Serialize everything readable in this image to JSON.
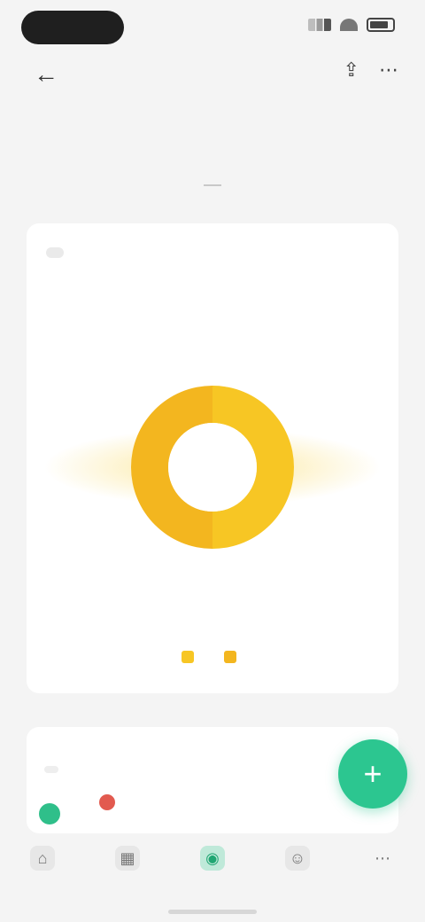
{
  "status_bar": {
    "time": ""
  },
  "header": {
    "title": ""
  },
  "tabs": [
    {
      "label": ""
    }
  ],
  "card": {
    "value": "",
    "subtitle": "",
    "legend": [
      {
        "label": "",
        "color": "#f7c624"
      },
      {
        "label": "",
        "color": "#f3b61f"
      }
    ]
  },
  "chart_data": {
    "type": "pie",
    "categories": [
      "",
      ""
    ],
    "values": [
      50,
      50
    ],
    "colors": [
      "#f7c624",
      "#f3b61f"
    ],
    "title": ""
  },
  "bottom_panel": {
    "title": "",
    "value": ""
  },
  "fab": {
    "icon": "plus-icon"
  },
  "nav": [
    {
      "label": "",
      "icon": "home-icon"
    },
    {
      "label": "",
      "icon": "chart-icon"
    },
    {
      "label": "",
      "icon": "wallet-icon"
    },
    {
      "label": "",
      "icon": "user-icon"
    },
    {
      "label": "",
      "icon": "more-icon"
    }
  ],
  "colors": {
    "accent": "#2cc690",
    "donut": "#f7c624",
    "red": "#e25a4f"
  }
}
